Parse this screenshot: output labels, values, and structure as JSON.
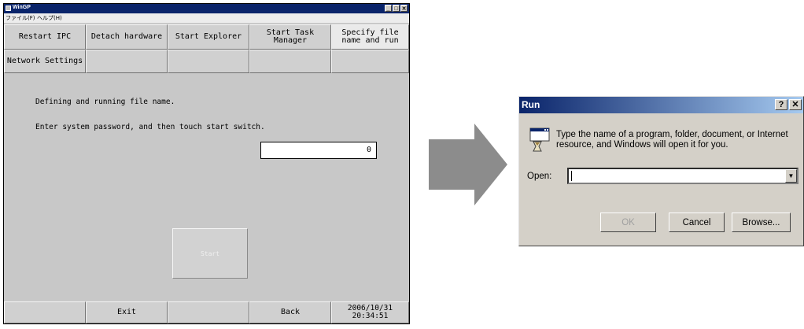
{
  "wingp": {
    "title": "WinGP",
    "menu": [
      "ファイル(F)",
      "ヘルプ(H)"
    ],
    "title_buttons": [
      "_",
      "□",
      "✕"
    ],
    "top_buttons": [
      "Restart IPC",
      "Detach hardware",
      "Start Explorer",
      "Start Task Manager",
      "Specify file name and run"
    ],
    "second_row": [
      "Network Settings",
      "",
      "",
      "",
      ""
    ],
    "message1": "Defining and running file name.",
    "message2": "Enter system password, and then touch start switch.",
    "password_value": "0",
    "start_label": "Start",
    "bottom_buttons": [
      "",
      "Exit",
      "",
      "Back",
      "2006/10/31\n20:34:51"
    ],
    "active_tab_index": 4
  },
  "run_dialog": {
    "title": "Run",
    "help_button": "?",
    "close_button": "✕",
    "description": "Type the name of a program, folder, document, or Internet resource, and Windows will open it for you.",
    "open_label": "Open:",
    "open_value": "",
    "ok_label": "OK",
    "cancel_label": "Cancel",
    "browse_label": "Browse..."
  },
  "colors": {
    "titlebar": "#0a246a",
    "window_bg": "#c8c8c8",
    "dialog_bg": "#d4d0c8",
    "arrow": "#8c8c8c"
  },
  "icons": [
    "wingp-app-icon",
    "run-program-icon",
    "combo-dropdown-icon",
    "transition-arrow-icon"
  ]
}
